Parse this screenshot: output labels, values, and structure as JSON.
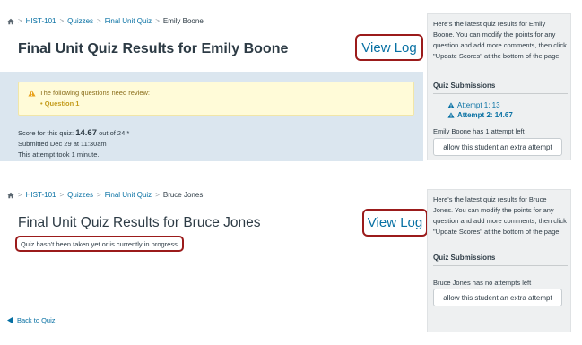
{
  "colors": {
    "link": "#0770a3",
    "highlight_border": "#9b1b1b",
    "warning_bg": "#fffbd8",
    "info_bg": "#dbe6ef",
    "sidebar_bg": "#eef0f1"
  },
  "panel1": {
    "breadcrumb": {
      "home_icon": "home-icon",
      "course": "HIST-101",
      "section": "Quizzes",
      "quiz": "Final Unit Quiz",
      "current": "Emily Boone"
    },
    "title": "Final Unit Quiz Results for Emily Boone",
    "view_log": "View Log",
    "warning": {
      "icon": "warning-icon",
      "text": "The following questions need review:",
      "item": "Question 1"
    },
    "score": {
      "prefix": "Score for this quiz: ",
      "value": "14.67",
      "suffix": " out of 24 *"
    },
    "submitted": "Submitted Dec 29 at 11:30am",
    "duration": "This attempt took 1 minute.",
    "sidebar": {
      "intro": "Here's the latest quiz results for Emily Boone. You can modify the points for any question and add more comments, then click \"Update Scores\" at the bottom of the page.",
      "heading": "Quiz Submissions",
      "attempts": [
        {
          "label": "Attempt 1: 13",
          "icon": "warning-icon"
        },
        {
          "label": "Attempt 2: 14.67",
          "icon": "warning-icon"
        }
      ],
      "attempts_left": "Emily Boone has 1 attempt left",
      "extra_button": "allow this student an extra attempt"
    }
  },
  "panel2": {
    "breadcrumb": {
      "home_icon": "home-icon",
      "course": "HIST-101",
      "section": "Quizzes",
      "quiz": "Final Unit Quiz",
      "current": "Bruce Jones"
    },
    "title": "Final Unit Quiz Results for Bruce Jones",
    "view_log": "View Log",
    "status": "Quiz hasn't been taken yet or is currently in progress",
    "sidebar": {
      "intro": "Here's the latest quiz results for Bruce Jones. You can modify the points for any question and add more comments, then click \"Update Scores\" at the bottom of the page.",
      "heading": "Quiz Submissions",
      "attempts_left": "Bruce Jones has no attempts left",
      "extra_button": "allow this student an extra attempt",
      "back_link": "Back to Quiz"
    }
  }
}
